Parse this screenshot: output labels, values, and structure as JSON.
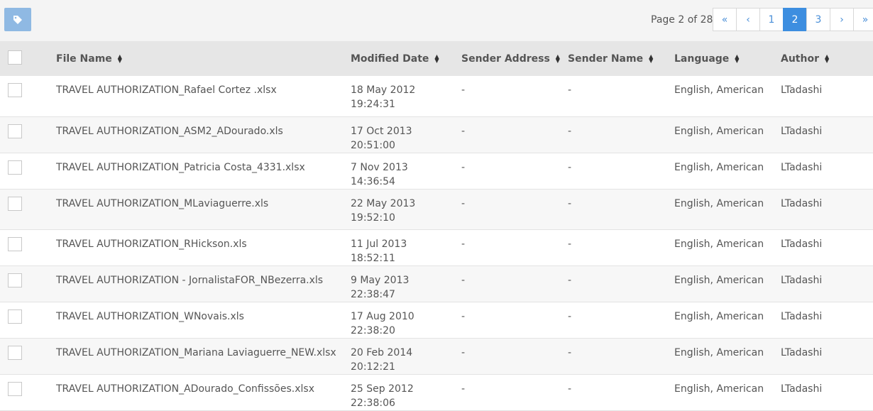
{
  "toolbar": {
    "tag_icon": "tag-icon",
    "page_info": "Page 2 of 28"
  },
  "pagination": [
    "«",
    "‹",
    "1",
    "2",
    "3",
    "›",
    "»"
  ],
  "table": {
    "columns": [
      "File Name",
      "Modified Date",
      "Sender Address",
      "Sender Name",
      "Language",
      "Author"
    ],
    "rows": [
      {
        "file": "TRAVEL AUTHORIZATION_Rafael Cortez .xlsx",
        "date": "18 May 2012 19:24:31",
        "sender_address": "-",
        "sender_name": "-",
        "language": "English, American",
        "author": "LTadashi"
      },
      {
        "file": "TRAVEL AUTHORIZATION_ASM2_ADourado.xls",
        "date": "17 Oct 2013 20:51:00",
        "sender_address": "-",
        "sender_name": "-",
        "language": "English, American",
        "author": "LTadashi"
      },
      {
        "file": "TRAVEL AUTHORIZATION_Patricia Costa_4331.xlsx",
        "date": "7 Nov 2013 14:36:54",
        "sender_address": "-",
        "sender_name": "-",
        "language": "English, American",
        "author": "LTadashi"
      },
      {
        "file": "TRAVEL AUTHORIZATION_MLaviaguerre.xls",
        "date": "22 May 2013 19:52:10",
        "sender_address": "-",
        "sender_name": "-",
        "language": "English, American",
        "author": "LTadashi"
      },
      {
        "file": "TRAVEL AUTHORIZATION_RHickson.xls",
        "date": "11 Jul 2013 18:52:11",
        "sender_address": "-",
        "sender_name": "-",
        "language": "English, American",
        "author": "LTadashi"
      },
      {
        "file": "TRAVEL AUTHORIZATION - JornalistaFOR_NBezerra.xls",
        "date": "9 May 2013 22:38:47",
        "sender_address": "-",
        "sender_name": "-",
        "language": "English, American",
        "author": "LTadashi"
      },
      {
        "file": "TRAVEL AUTHORIZATION_WNovais.xls",
        "date": "17 Aug 2010 22:38:20",
        "sender_address": "-",
        "sender_name": "-",
        "language": "English, American",
        "author": "LTadashi"
      },
      {
        "file": "TRAVEL AUTHORIZATION_Mariana Laviaguerre_NEW.xlsx",
        "date": "20 Feb 2014 20:12:21",
        "sender_address": "-",
        "sender_name": "-",
        "language": "English, American",
        "author": "LTadashi"
      },
      {
        "file": "TRAVEL AUTHORIZATION_ADourado_Confissões.xlsx",
        "date": "25 Sep 2012 22:38:06",
        "sender_address": "-",
        "sender_name": "-",
        "language": "English, American",
        "author": "LTadashi"
      }
    ]
  }
}
